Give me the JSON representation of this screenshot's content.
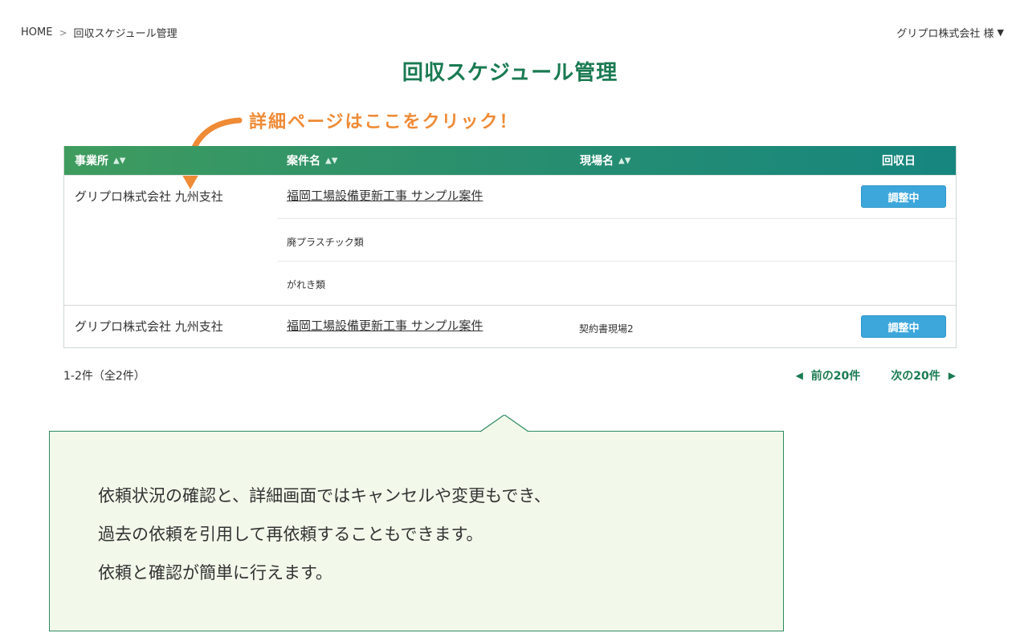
{
  "breadcrumb": {
    "home": "HOME",
    "separator": ">",
    "current": "回収スケジュール管理"
  },
  "user": {
    "name": "グリプロ株式会社 様",
    "caret": "▼"
  },
  "page_title": "回収スケジュール管理",
  "callout": {
    "text": "詳細ページはここをクリック！"
  },
  "table": {
    "headers": {
      "office": "事業所",
      "case": "案件名",
      "site": "現場名",
      "date": "回収日",
      "sort_icon": "▲▼"
    },
    "groups": [
      {
        "office": "グリプロ株式会社 九州支社",
        "case": "福岡工場設備更新工事 サンプル案件",
        "status": "調整中",
        "items": [
          "廃プラスチック類",
          "がれき類"
        ]
      },
      {
        "office": "グリプロ株式会社 九州支社",
        "case": "福岡工場設備更新工事 サンプル案件",
        "site": "契約書現場2",
        "status": "調整中"
      }
    ]
  },
  "result_count": "1-2件（全2件）",
  "pager": {
    "prev": "前の20件",
    "next": "次の20件",
    "prev_icon": "◀",
    "next_icon": "▶"
  },
  "info": {
    "line1": "依頼状況の確認と、詳細画面ではキャンセルや変更もでき、",
    "line2": "過去の依頼を引用して再依頼することもできます。",
    "line3": "依頼と確認が簡単に行えます。"
  },
  "colors": {
    "accent_green": "#1a7a52",
    "callout_orange": "#ef8a35",
    "badge_blue": "#3da7dc",
    "info_bg": "#f2f8ea"
  }
}
